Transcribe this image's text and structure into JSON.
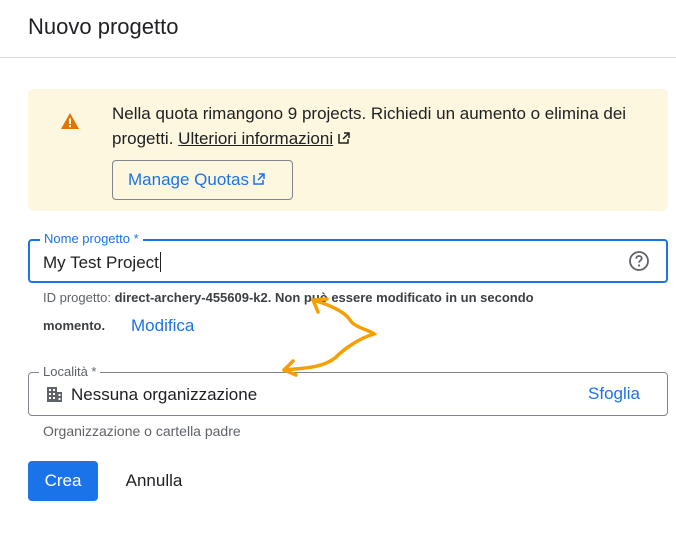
{
  "page": {
    "title": "Nuovo progetto"
  },
  "alert": {
    "icon": "warning-icon",
    "icon_color": "#e37400",
    "text": "Nella quota rimangono 9 projects. Richiedi un aumento o elimina dei progetti.",
    "link_label": "Ulteriori informazioni",
    "button_label": "Manage Quotas",
    "background": "#fef7e0"
  },
  "project_name": {
    "label": "Nome progetto *",
    "value": "My Test Project",
    "help_icon": "help-circle-icon"
  },
  "project_id": {
    "prefix": "ID progetto:",
    "id": "direct-archery-455609-k2.",
    "note_line1": "Non può essere modificato in un secondo",
    "note_line2": "momento.",
    "edit_label": "Modifica"
  },
  "location": {
    "label": "Località *",
    "icon": "building-icon",
    "value": "Nessuna organizzazione",
    "browse_label": "Sfoglia",
    "helper": "Organizzazione o cartella padre"
  },
  "actions": {
    "create_label": "Crea",
    "cancel_label": "Annulla"
  },
  "colors": {
    "accent": "#1a73e8",
    "annotation": "#f5a000"
  }
}
